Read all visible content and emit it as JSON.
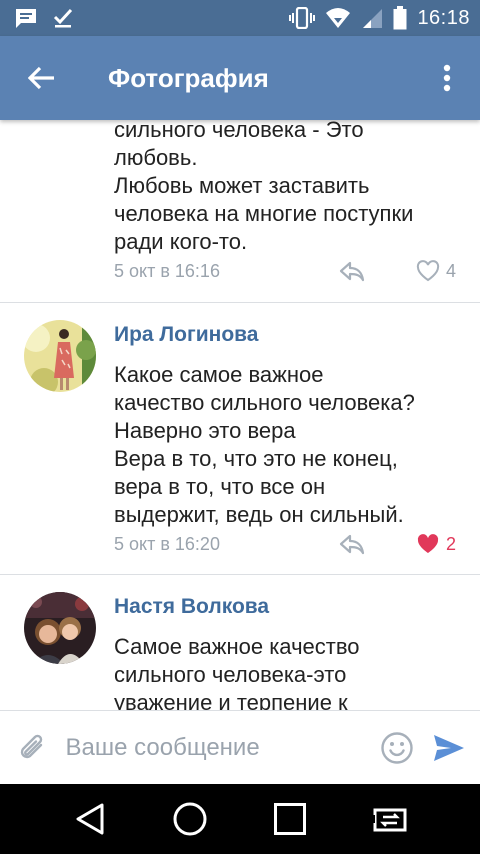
{
  "statusbar": {
    "time": "16:18"
  },
  "appbar": {
    "title": "Фотография"
  },
  "comments": [
    {
      "lines": [
        "сильного человека - Это",
        "любовь.",
        "Любовь может заставить",
        "человека на многие поступки",
        "ради кого-то."
      ],
      "time": "5 окт в 16:16",
      "likes": "4",
      "liked": false
    },
    {
      "name": "Ира Логинова",
      "lines": [
        "Какое самое важное",
        "качество сильного человека?",
        "Наверно это вера",
        "Вера в то, что это не конец,",
        "вера в то, что все он",
        "выдержит, ведь он сильный."
      ],
      "time": "5 окт в 16:20",
      "likes": "2",
      "liked": true
    },
    {
      "name": "Настя Волкова",
      "lines": [
        "Самое важное качество",
        "сильного человека-это",
        "уважение и терпение к"
      ]
    }
  ],
  "compose": {
    "placeholder": "Ваше сообщение"
  },
  "colors": {
    "statusbar": "#4a6d94",
    "appbar": "#5b82b3",
    "name": "#3f6b9c",
    "liked": "#e1385a",
    "send": "#5b8fd6"
  }
}
